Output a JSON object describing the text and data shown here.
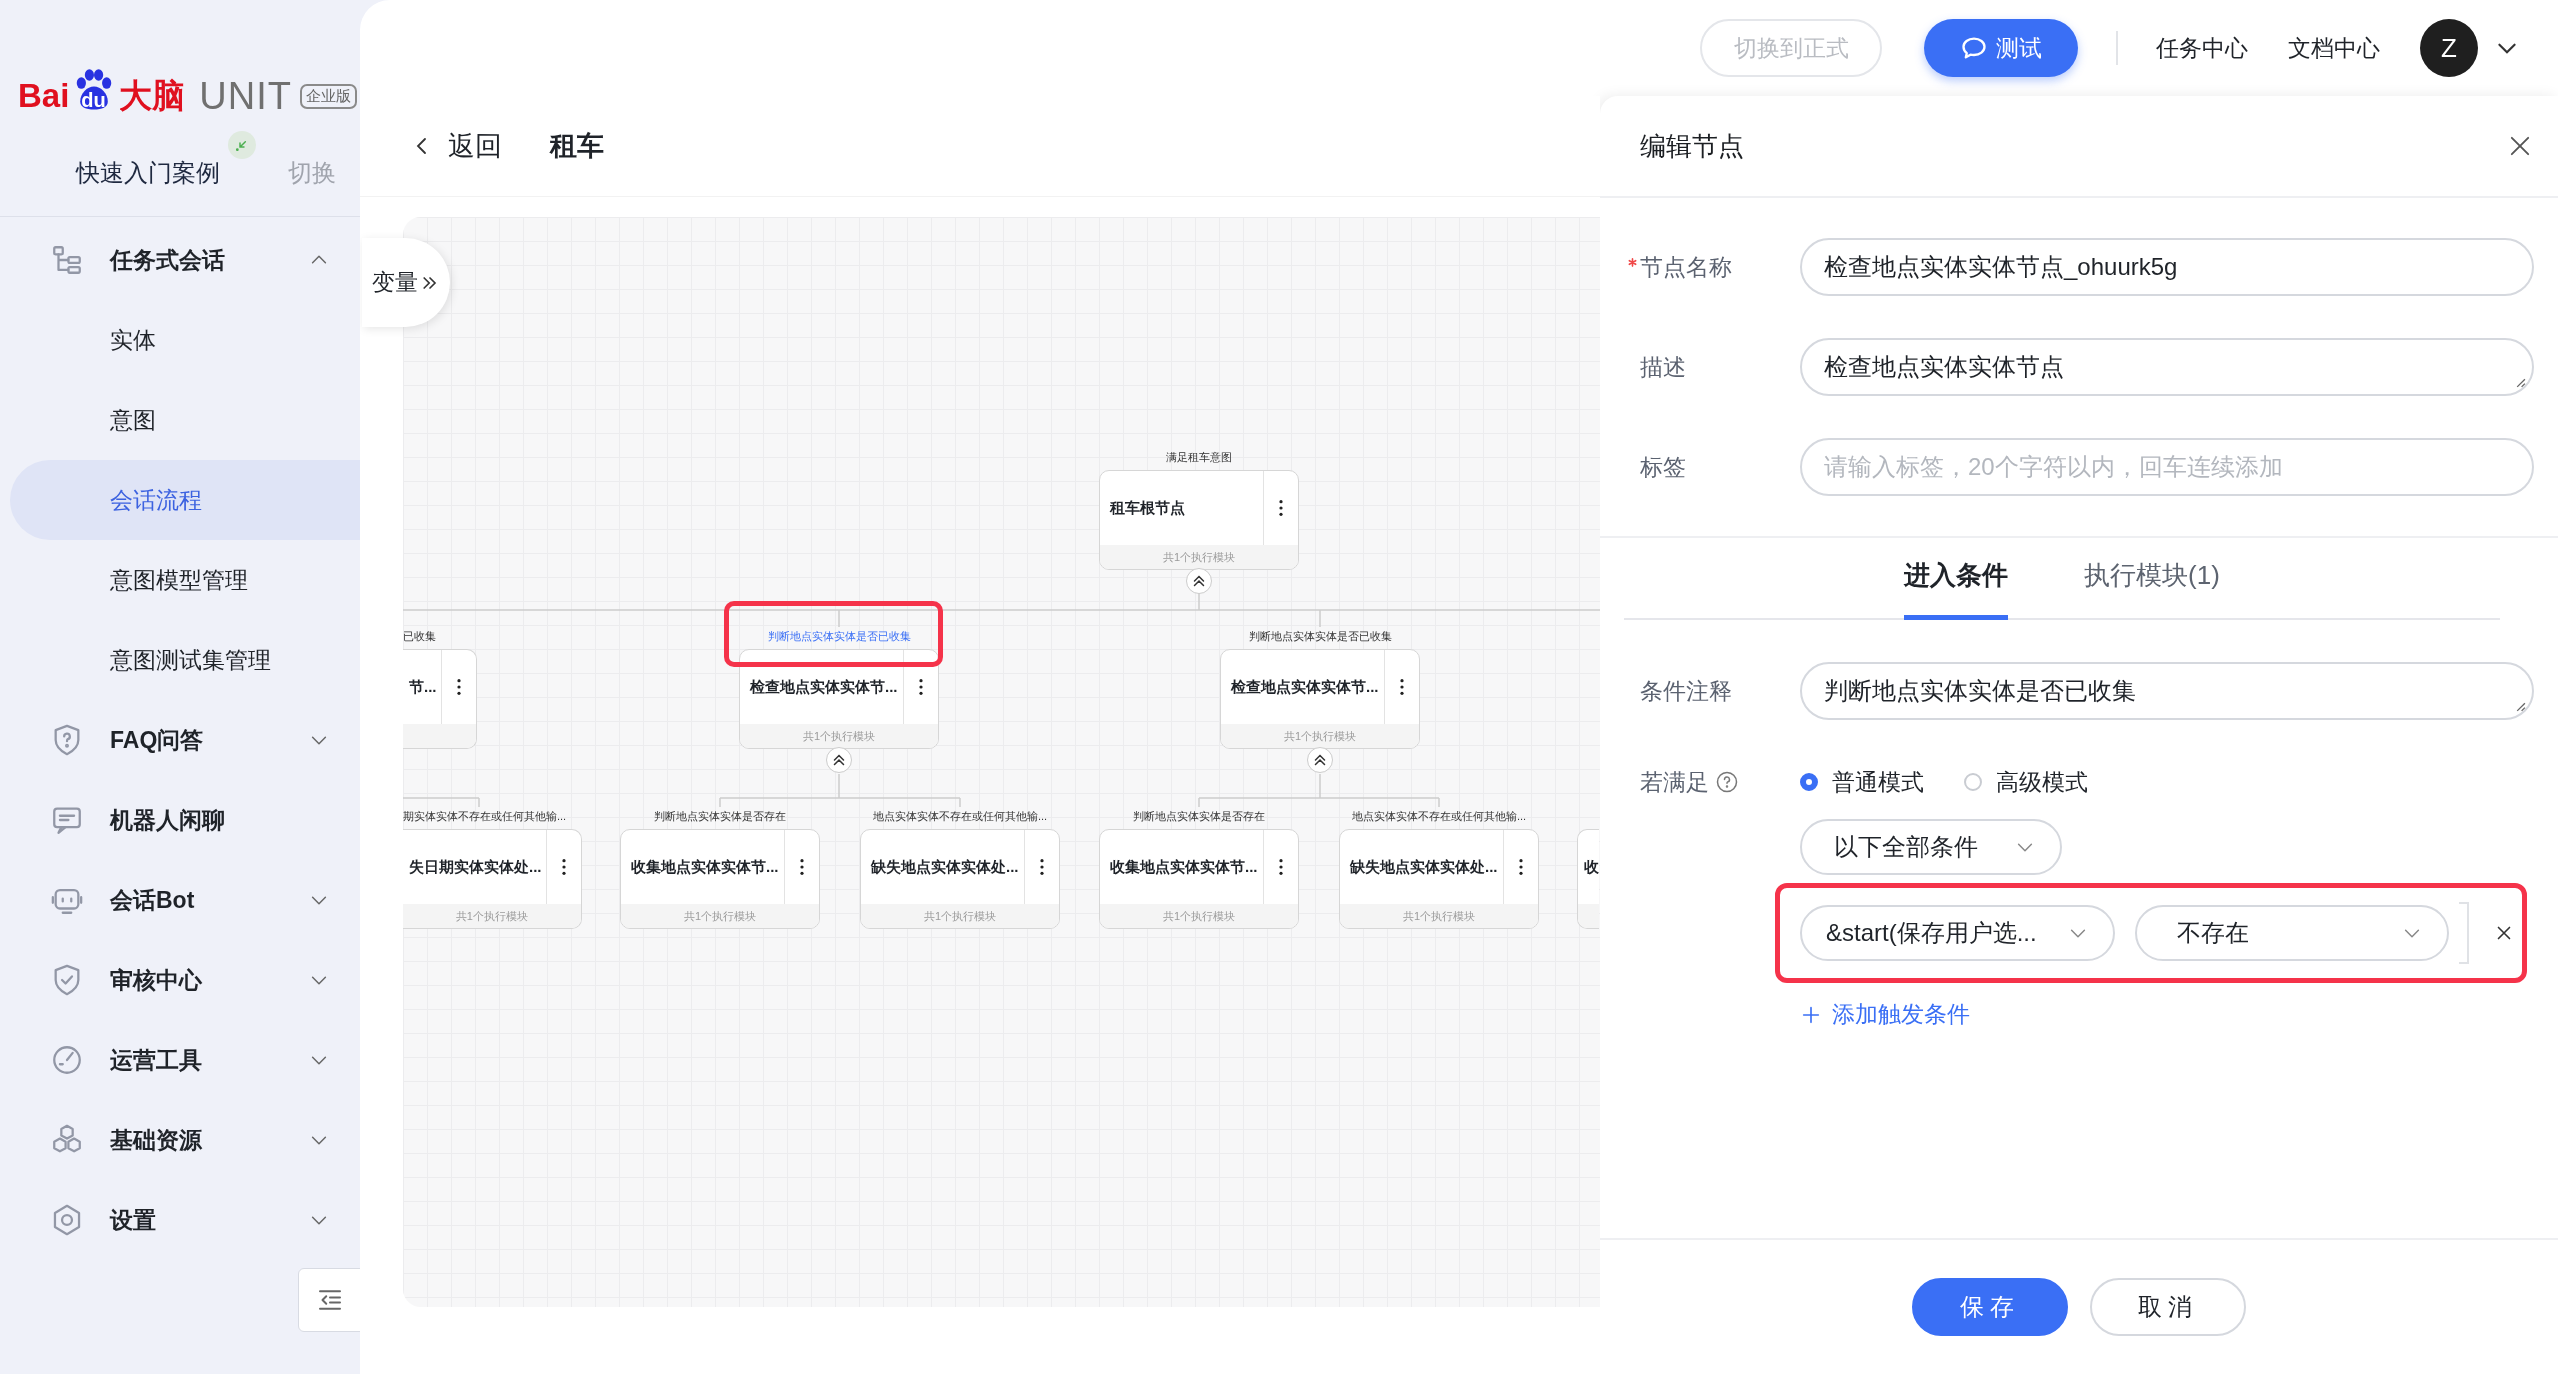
{
  "logo": {
    "text_1": "Bai",
    "mark_text": "du",
    "text_2": "大脑",
    "product": "UNIT",
    "edition": "企业版"
  },
  "project": {
    "name": "快速入门案例",
    "switch": "切换"
  },
  "sidebar": {
    "items": [
      {
        "label": "任务式会话",
        "kind": "group",
        "expanded": true,
        "children": [
          {
            "label": "实体",
            "selected": false
          },
          {
            "label": "意图",
            "selected": false
          },
          {
            "label": "会话流程",
            "selected": true
          },
          {
            "label": "意图模型管理",
            "selected": false
          },
          {
            "label": "意图测试集管理",
            "selected": false
          }
        ]
      },
      {
        "label": "FAQ问答",
        "kind": "group",
        "expanded": false
      },
      {
        "label": "机器人闲聊",
        "kind": "link"
      },
      {
        "label": "会话Bot",
        "kind": "group",
        "expanded": false
      },
      {
        "label": "审核中心",
        "kind": "group",
        "expanded": false
      },
      {
        "label": "运营工具",
        "kind": "group",
        "expanded": false
      },
      {
        "label": "基础资源",
        "kind": "group",
        "expanded": false
      },
      {
        "label": "设置",
        "kind": "group",
        "expanded": false
      }
    ]
  },
  "topbar": {
    "buttons": [
      {
        "label": "切换到正式",
        "kind": "outline",
        "disabled": true
      },
      {
        "label": "测试",
        "kind": "primary"
      }
    ],
    "links": [
      "任务中心",
      "文档中心"
    ],
    "avatar": "Z"
  },
  "page": {
    "back": "返回",
    "title": "租车",
    "variables_tab": "变量"
  },
  "canvas": {
    "root": {
      "kind": "full",
      "label": "满足租车意图",
      "title": "租车根节点",
      "footer": "共1个执行模块",
      "selected": false,
      "expanded": true,
      "children": [
        {
          "kind": "partial",
          "label": "已收集",
          "title": "节...",
          "selected": false,
          "children": [
            {
              "kind": "partial",
              "label": "期实体实体不存在或任何其他输...",
              "title": "失日期实体实体处...",
              "footer": "共1个执行模块",
              "selected": false
            }
          ]
        },
        {
          "kind": "full",
          "label": "判断地点实体实体是否已收集",
          "title": "检查地点实体实体节...",
          "footer": "共1个执行模块",
          "selected": true,
          "expanded": true,
          "children": [
            {
              "kind": "full",
              "label": "判断地点实体实体是否存在",
              "title": "收集地点实体实体节...",
              "footer": "共1个执行模块",
              "selected": false
            },
            {
              "kind": "full",
              "label": "地点实体实体不存在或任何其他输...",
              "title": "缺失地点实体实体处...",
              "footer": "共1个执行模块",
              "selected": false
            }
          ]
        },
        {
          "kind": "full",
          "label": "判断地点实体实体是否已收集",
          "title": "检查地点实体实体节...",
          "footer": "共1个执行模块",
          "selected": false,
          "expanded": true,
          "children": [
            {
              "kind": "full",
              "label": "判断地点实体实体是否存在",
              "title": "收集地点实体实体节...",
              "footer": "共1个执行模块",
              "selected": false
            },
            {
              "kind": "full",
              "label": "地点实体实体不存在或任何其他输...",
              "title": "缺失地点实体实体处...",
              "footer": "共1个执行模块",
              "selected": false
            }
          ]
        }
      ]
    },
    "cut_off_nodes": [
      {
        "kind": "partial",
        "title": "收"
      }
    ]
  },
  "panel": {
    "title": "编辑节点",
    "fields": [
      {
        "label": "节点名称",
        "kind": "input",
        "required": true,
        "value": "检查地点实体实体节点_ohuurk5g"
      },
      {
        "label": "描述",
        "kind": "textarea",
        "value": "检查地点实体实体节点"
      },
      {
        "label": "标签",
        "kind": "input",
        "placeholder": "请输入标签，20个字符以内，回车连续添加"
      }
    ],
    "tabs": [
      {
        "label": "进入条件",
        "selected": true
      },
      {
        "label": "执行模块(1)",
        "selected": false
      }
    ],
    "condition": {
      "note_label": "条件注释",
      "note_value": "判断地点实体实体是否已收集",
      "match_label": "若满足",
      "modes": [
        {
          "label": "普通模式",
          "selected": true
        },
        {
          "label": "高级模式",
          "selected": false
        }
      ],
      "scope": "以下全部条件",
      "rules": [
        {
          "variable": "&start(保存用户选...",
          "operator": "不存在",
          "highlighted": true
        }
      ],
      "add": "添加触发条件"
    },
    "actions": [
      {
        "label": "保存",
        "kind": "primary"
      },
      {
        "label": "取消",
        "kind": "default"
      }
    ]
  }
}
